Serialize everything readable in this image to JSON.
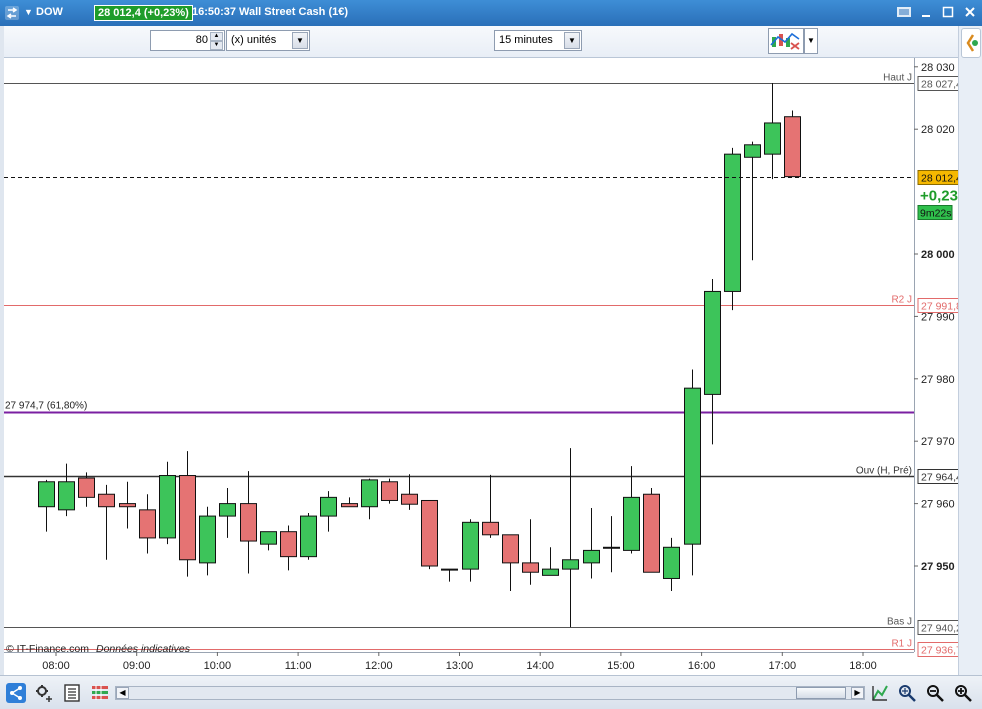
{
  "titlebar": {
    "symbol": "DOW",
    "price_box": "28 012,4 (+0,23%)",
    "time": "16:50:37",
    "market": "Wall Street Cash (1€)",
    "icons": [
      "menu-icon",
      "minimize-icon",
      "restore-icon",
      "close-icon"
    ]
  },
  "toolbar": {
    "units_value": "80",
    "units_label": "(x) unités",
    "interval_label": "15 minutes"
  },
  "chart_data": {
    "type": "candlestick",
    "y_ticks": [
      {
        "v": 28030,
        "label": "28 030",
        "bold": false
      },
      {
        "v": 28020,
        "label": "28 020",
        "bold": false
      },
      {
        "v": 28000,
        "label": "28 000",
        "bold": true
      },
      {
        "v": 27990,
        "label": "27 990",
        "bold": false
      },
      {
        "v": 27980,
        "label": "27 980",
        "bold": false
      },
      {
        "v": 27970,
        "label": "27 970",
        "bold": false
      },
      {
        "v": 27960,
        "label": "27 960",
        "bold": false
      },
      {
        "v": 27950,
        "label": "27 950",
        "bold": true
      }
    ],
    "x_ticks": [
      "08:00",
      "09:00",
      "10:00",
      "11:00",
      "12:00",
      "13:00",
      "14:00",
      "15:00",
      "16:00",
      "17:00",
      "18:00"
    ],
    "x_tick_times": [
      8,
      9,
      10,
      11,
      12,
      13,
      14,
      15,
      16,
      17,
      18
    ],
    "levels": [
      {
        "name": "Haut J",
        "value": 28027.4,
        "label": "28 027,4",
        "color": "#555555"
      },
      {
        "name": "R2 J",
        "value": 27991.8,
        "label": "27 991,8",
        "color": "#e26a6a"
      },
      {
        "name": "Ouv (H, Pré)",
        "value": 27964.4,
        "label": "27 964,4",
        "color": "#333333"
      },
      {
        "name": "Bas J",
        "value": 27940.2,
        "label": "27 940,2",
        "color": "#555555"
      },
      {
        "name": "R1 J",
        "value": 27936.7,
        "label": "27 936,7",
        "color": "#e26a6a"
      }
    ],
    "fib": {
      "label": "27 974,7 (61,80%)",
      "value": 27974.7,
      "color": "#7a1fa2"
    },
    "current": {
      "value": 28012.4,
      "label": "28 012,4",
      "pct": "+0,23%",
      "countdown": "9m22s"
    },
    "watermark": "© IT-Finance.com",
    "watermark_note": "Données indicatives",
    "candles": [
      {
        "t": 7.875,
        "o": 27959.5,
        "h": 27963.8,
        "l": 27955.5,
        "c": 27963.5
      },
      {
        "t": 8.125,
        "o": 27959.0,
        "h": 27966.4,
        "l": 27958.0,
        "c": 27963.5
      },
      {
        "t": 8.375,
        "o": 27964.1,
        "h": 27965.0,
        "l": 27959.5,
        "c": 27961.0
      },
      {
        "t": 8.625,
        "o": 27961.5,
        "h": 27963.0,
        "l": 27951.0,
        "c": 27959.5
      },
      {
        "t": 8.875,
        "o": 27960.0,
        "h": 27963.5,
        "l": 27956.0,
        "c": 27959.5
      },
      {
        "t": 9.125,
        "o": 27959.0,
        "h": 27961.5,
        "l": 27952.0,
        "c": 27954.5
      },
      {
        "t": 9.375,
        "o": 27954.5,
        "h": 27966.7,
        "l": 27953.5,
        "c": 27964.5
      },
      {
        "t": 9.625,
        "o": 27964.5,
        "h": 27968.4,
        "l": 27948.3,
        "c": 27951.0
      },
      {
        "t": 9.875,
        "o": 27950.5,
        "h": 27959.5,
        "l": 27948.5,
        "c": 27958.0
      },
      {
        "t": 10.125,
        "o": 27958.0,
        "h": 27962.5,
        "l": 27954.5,
        "c": 27960.0
      },
      {
        "t": 10.375,
        "o": 27960.0,
        "h": 27965.2,
        "l": 27948.8,
        "c": 27954.0
      },
      {
        "t": 10.625,
        "o": 27953.5,
        "h": 27955.5,
        "l": 27952.5,
        "c": 27955.5
      },
      {
        "t": 10.875,
        "o": 27955.5,
        "h": 27956.5,
        "l": 27949.3,
        "c": 27951.5
      },
      {
        "t": 11.125,
        "o": 27951.5,
        "h": 27958.5,
        "l": 27951.0,
        "c": 27958.0
      },
      {
        "t": 11.375,
        "o": 27958.0,
        "h": 27962.0,
        "l": 27955.5,
        "c": 27961.0
      },
      {
        "t": 11.625,
        "o": 27960.0,
        "h": 27961.0,
        "l": 27959.5,
        "c": 27959.5
      },
      {
        "t": 11.875,
        "o": 27959.5,
        "h": 27964.0,
        "l": 27957.5,
        "c": 27963.8
      },
      {
        "t": 12.125,
        "o": 27963.5,
        "h": 27964.0,
        "l": 27960.0,
        "c": 27960.5
      },
      {
        "t": 12.375,
        "o": 27961.5,
        "h": 27964.7,
        "l": 27959.0,
        "c": 27959.9
      },
      {
        "t": 12.625,
        "o": 27960.5,
        "h": 27960.5,
        "l": 27949.5,
        "c": 27950.0
      },
      {
        "t": 12.875,
        "o": 27949.5,
        "h": 27949.5,
        "l": 27947.5,
        "c": 27949.5
      },
      {
        "t": 13.125,
        "o": 27949.5,
        "h": 27957.5,
        "l": 27947.5,
        "c": 27957.0
      },
      {
        "t": 13.375,
        "o": 27957.0,
        "h": 27964.6,
        "l": 27954.5,
        "c": 27955.0
      },
      {
        "t": 13.625,
        "o": 27955.0,
        "h": 27955.0,
        "l": 27946.0,
        "c": 27950.5
      },
      {
        "t": 13.875,
        "o": 27950.5,
        "h": 27957.5,
        "l": 27947.0,
        "c": 27949.0
      },
      {
        "t": 14.125,
        "o": 27948.5,
        "h": 27953.0,
        "l": 27948.5,
        "c": 27949.5
      },
      {
        "t": 14.375,
        "o": 27949.5,
        "h": 27968.9,
        "l": 27940.2,
        "c": 27951.0
      },
      {
        "t": 14.625,
        "o": 27950.5,
        "h": 27959.3,
        "l": 27948.0,
        "c": 27952.5
      },
      {
        "t": 14.875,
        "o": 27953.0,
        "h": 27958.0,
        "l": 27949.0,
        "c": 27953.0
      },
      {
        "t": 15.125,
        "o": 27952.5,
        "h": 27966.0,
        "l": 27952.0,
        "c": 27961.0
      },
      {
        "t": 15.375,
        "o": 27961.5,
        "h": 27962.5,
        "l": 27949.0,
        "c": 27949.0
      },
      {
        "t": 15.625,
        "o": 27948.0,
        "h": 27954.5,
        "l": 27946.0,
        "c": 27953.0
      },
      {
        "t": 15.875,
        "o": 27953.5,
        "h": 27981.5,
        "l": 27948.5,
        "c": 27978.5
      },
      {
        "t": 16.125,
        "o": 27977.5,
        "h": 27996.0,
        "l": 27969.5,
        "c": 27994.0
      },
      {
        "t": 16.375,
        "o": 27994.0,
        "h": 28017.0,
        "l": 27991.0,
        "c": 28016.0
      },
      {
        "t": 16.625,
        "o": 28015.5,
        "h": 28018.0,
        "l": 27999.0,
        "c": 28017.5
      },
      {
        "t": 16.875,
        "o": 28016.0,
        "h": 28027.4,
        "l": 28012.0,
        "c": 28021.0
      },
      {
        "t": 17.125,
        "o": 28022.0,
        "h": 28023.0,
        "l": 28012.4,
        "c": 28012.4
      }
    ]
  }
}
